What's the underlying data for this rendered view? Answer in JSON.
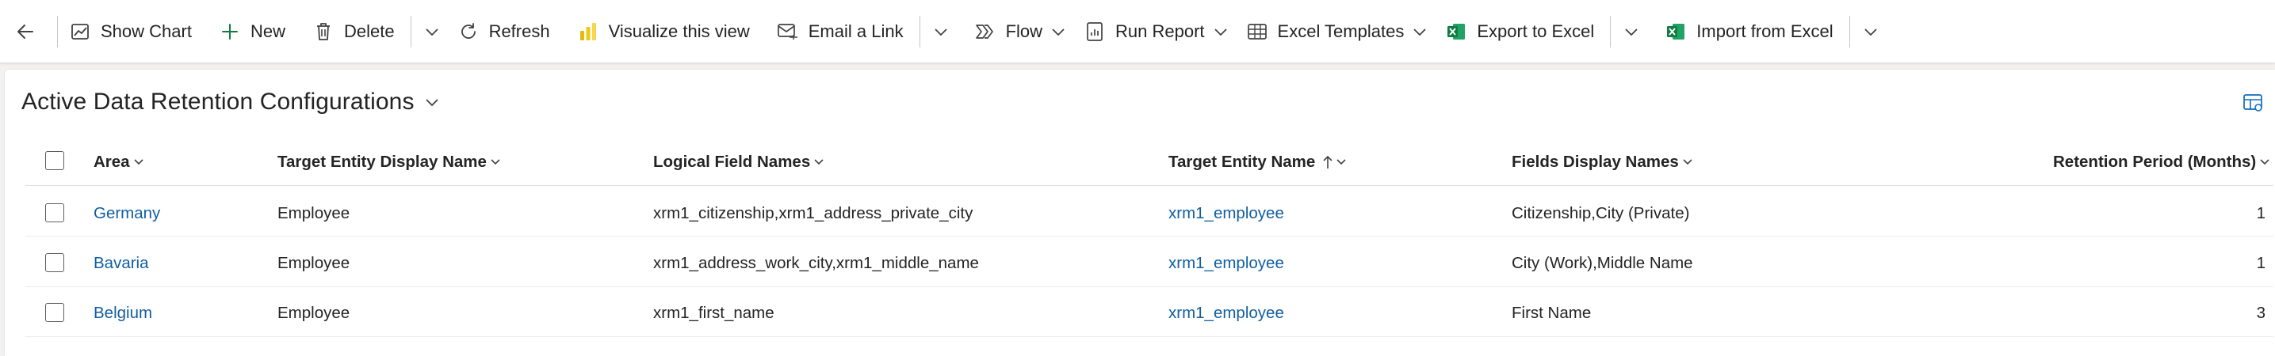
{
  "toolbar": {
    "back_label": "",
    "show_chart": "Show Chart",
    "new": "New",
    "delete": "Delete",
    "refresh": "Refresh",
    "visualize": "Visualize this view",
    "email_link": "Email a Link",
    "flow": "Flow",
    "run_report": "Run Report",
    "excel_templates": "Excel Templates",
    "export_excel": "Export to Excel",
    "import_excel": "Import from Excel"
  },
  "icons": {
    "back": "arrow-left-icon",
    "show_chart": "chart-icon",
    "new": "plus-icon",
    "delete": "trash-icon",
    "refresh": "refresh-icon",
    "visualize": "power-bi-icon",
    "email_link": "email-link-icon",
    "flow": "flow-icon",
    "run_report": "report-icon",
    "excel_templates": "excel-templates-icon",
    "export_excel": "excel-icon",
    "import_excel": "excel-import-icon",
    "edit_columns": "edit-columns-icon"
  },
  "colors": {
    "link": "#115ea3",
    "excel_green": "#107c41",
    "powerbi_yellow": "#f2c811",
    "accent": "#0f6cbd"
  },
  "view": {
    "title": "Active Data Retention Configurations"
  },
  "grid": {
    "columns": [
      {
        "label": "Area",
        "sort": "none"
      },
      {
        "label": "Target Entity Display Name",
        "sort": "none"
      },
      {
        "label": "Logical Field Names",
        "sort": "none"
      },
      {
        "label": "Target Entity Name",
        "sort": "ascending"
      },
      {
        "label": "Fields Display Names",
        "sort": "none"
      },
      {
        "label": "Retention Period (Months)",
        "sort": "none"
      }
    ],
    "rows": [
      {
        "area": "Germany",
        "target_entity_display_name": "Employee",
        "logical_field_names": "xrm1_citizenship,xrm1_address_private_city",
        "target_entity_name": "xrm1_employee",
        "fields_display_names": "Citizenship,City (Private)",
        "retention_period": "1"
      },
      {
        "area": "Bavaria",
        "target_entity_display_name": "Employee",
        "logical_field_names": "xrm1_address_work_city,xrm1_middle_name",
        "target_entity_name": "xrm1_employee",
        "fields_display_names": "City (Work),Middle Name",
        "retention_period": "1"
      },
      {
        "area": "Belgium",
        "target_entity_display_name": "Employee",
        "logical_field_names": "xrm1_first_name",
        "target_entity_name": "xrm1_employee",
        "fields_display_names": "First Name",
        "retention_period": "3"
      }
    ]
  }
}
